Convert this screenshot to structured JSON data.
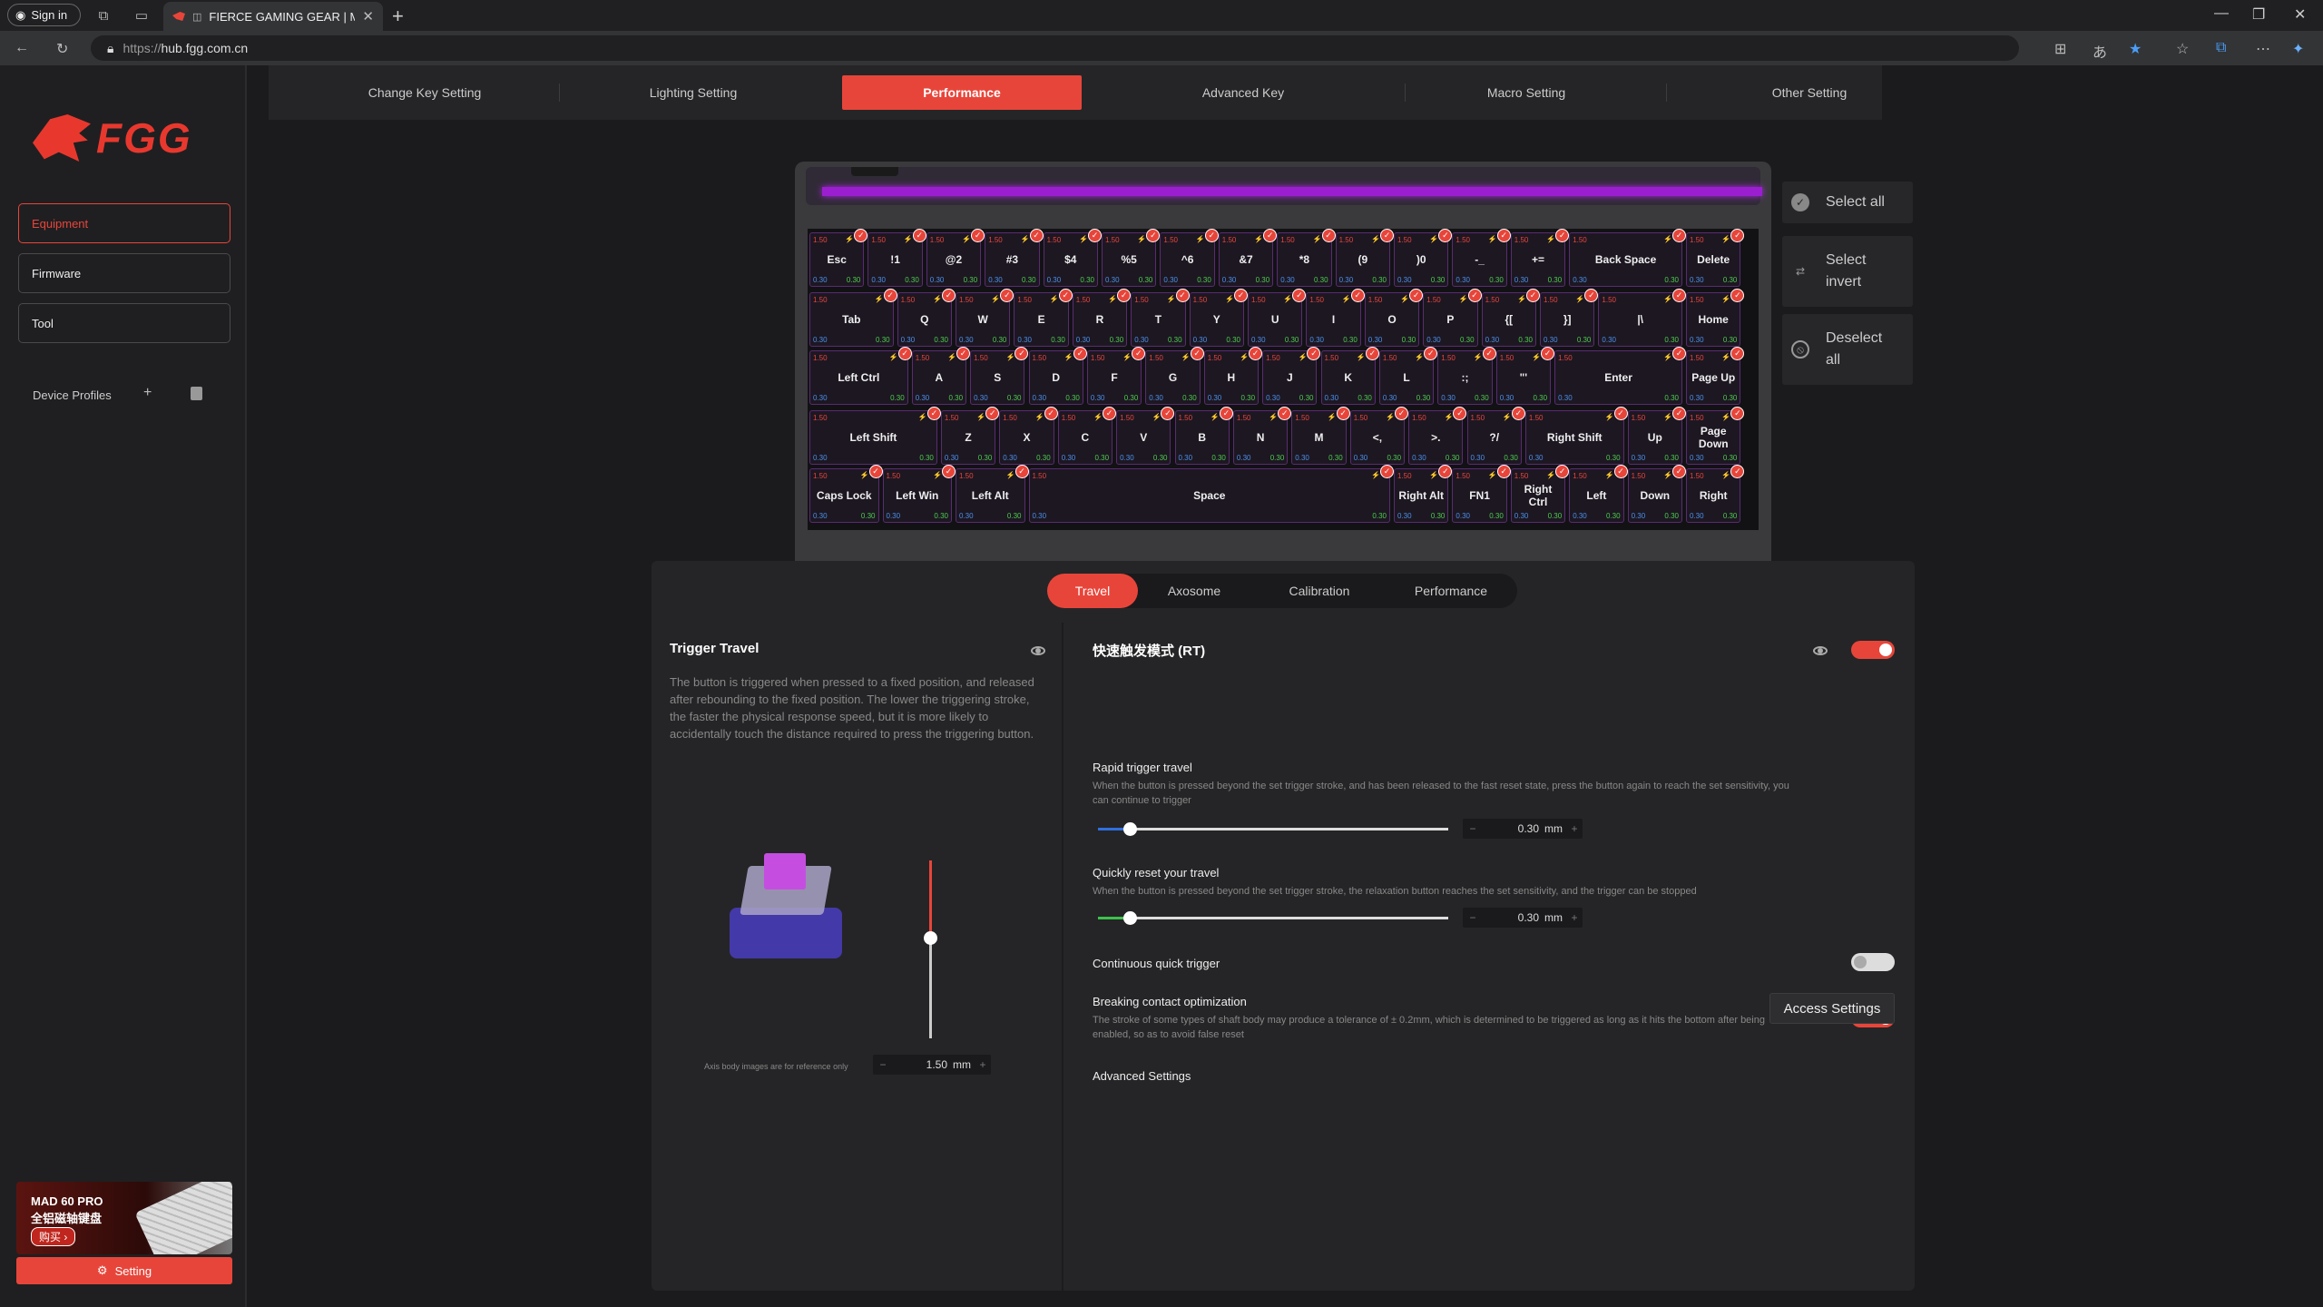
{
  "browser": {
    "sign_in": "Sign in",
    "tab_title": "FIERCE GAMING GEAR | MA",
    "url_prefix": "https://",
    "url_host": "hub.fgg.com.cn"
  },
  "sidebar": {
    "logo_text": "FGG",
    "items": [
      {
        "label": "Equipment",
        "active": true
      },
      {
        "label": "Firmware",
        "active": false
      },
      {
        "label": "Tool",
        "active": false
      }
    ],
    "device_profiles": "Device Profiles",
    "promo": {
      "line1": "MAD 60 PRO",
      "line2": "全铝磁轴键盘",
      "buy": "购买 ›"
    },
    "setting": "Setting"
  },
  "topnav": {
    "tabs": [
      "Change Key Setting",
      "Lighting Setting",
      "Performance",
      "Advanced Key",
      "Macro Setting",
      "Other Setting"
    ],
    "active": "Performance"
  },
  "keyboard": {
    "default_trigger": "1.50",
    "default_rt": "0.30",
    "accent_color": "#e8453a",
    "light_color": "#9b1fd0",
    "rows": [
      [
        "Esc",
        "!1",
        "@2",
        "#3",
        "$4",
        "%5",
        "^6",
        "&7",
        "*8",
        "(9",
        ")0",
        "-_",
        "+=",
        "Back Space",
        "Delete"
      ],
      [
        "Tab",
        "Q",
        "W",
        "E",
        "R",
        "T",
        "Y",
        "U",
        "I",
        "O",
        "P",
        "{[",
        "}]",
        "|\\",
        "Home"
      ],
      [
        "Left Ctrl",
        "A",
        "S",
        "D",
        "F",
        "G",
        "H",
        "J",
        "K",
        "L",
        ":;",
        "\"'",
        "Enter",
        "Page Up"
      ],
      [
        "Left Shift",
        "Z",
        "X",
        "C",
        "V",
        "B",
        "N",
        "M",
        "<,",
        ">.",
        "?/",
        "Right Shift",
        "Up",
        "Page Down"
      ],
      [
        "Caps Lock",
        "Left Win",
        "Left Alt",
        "Space",
        "Right Alt",
        "FN1",
        "Right Ctrl",
        "Left",
        "Down",
        "Right"
      ]
    ]
  },
  "selection": {
    "select_all": "Select all",
    "select_invert": "Select invert",
    "deselect_all": "Deselect all"
  },
  "panel": {
    "subtabs": [
      "Travel",
      "Axosome",
      "Calibration",
      "Performance"
    ],
    "active_subtab": "Travel",
    "trigger_travel": {
      "title": "Trigger Travel",
      "description": "The button is triggered when pressed to a fixed position, and released after rebounding to the fixed position. The lower the triggering stroke, the faster the physical response speed, but it is more likely to accidentally touch the distance required to press the triggering button.",
      "axis_note": "Axis body images are for reference only",
      "value": "1.50",
      "unit": "mm",
      "level": 0.43
    },
    "rt": {
      "title": "快速触发模式 (RT)",
      "enabled": true,
      "rapid_label": "Rapid trigger travel",
      "rapid_desc": "When the button is pressed beyond the set trigger stroke, and has been released to the fast reset state, press the button again to reach the set sensitivity, you can continue to trigger",
      "rapid_value": "0.30",
      "reset_label": "Quickly reset your travel",
      "reset_desc": "When the button is pressed beyond the set trigger stroke, the relaxation button reaches the set sensitivity, and the trigger can be stopped",
      "reset_value": "0.30",
      "unit": "mm",
      "continuous_label": "Continuous quick trigger",
      "continuous_on": false,
      "breaking_label": "Breaking contact optimization",
      "breaking_desc": "The stroke of some types of shaft body may produce a tolerance of ± 0.2mm, which is determined to be triggered as long as it hits the bottom after being enabled, so as to avoid false reset",
      "breaking_on": true,
      "advanced_label": "Advanced Settings",
      "access_button": "Access Settings"
    }
  }
}
